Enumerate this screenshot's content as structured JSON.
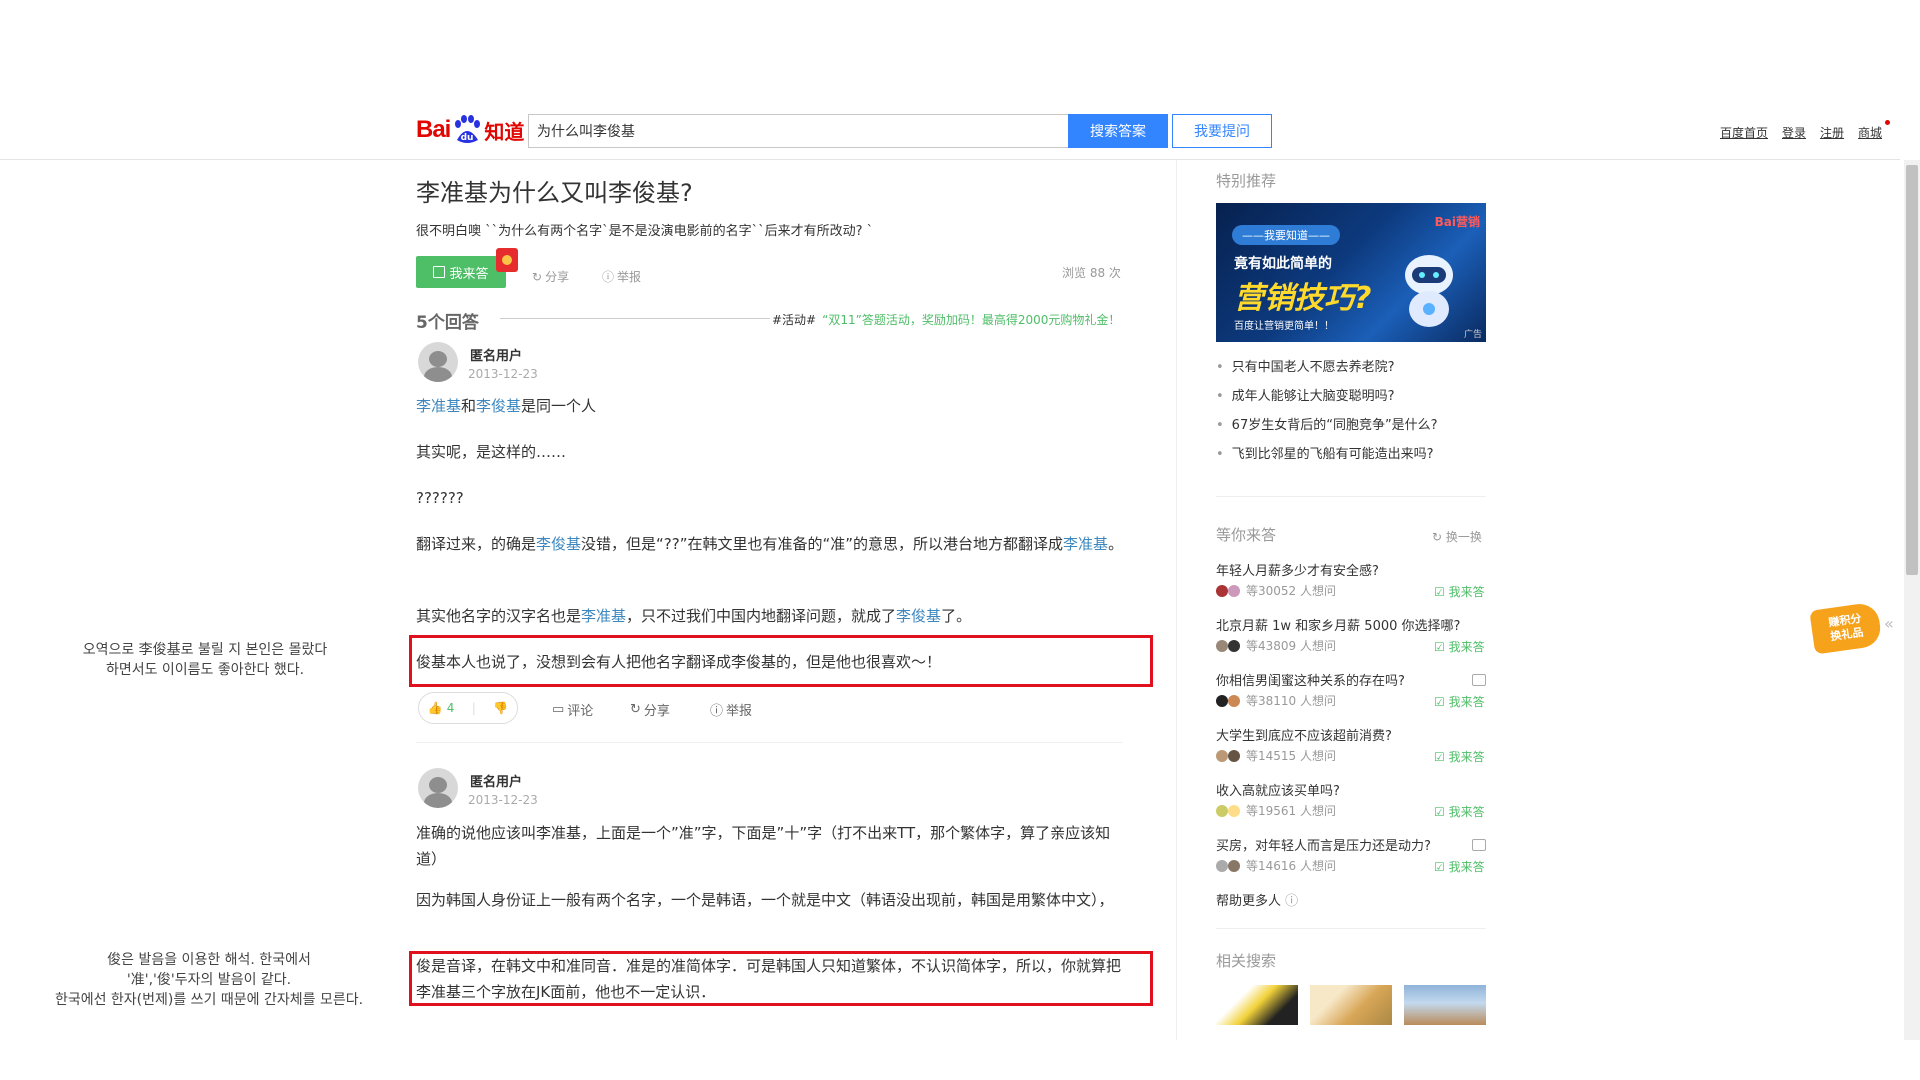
{
  "header": {
    "logo_bai": "Bai",
    "logo_du": "du",
    "logo_zhidao": "知道",
    "search_value": "为什么叫李俊基",
    "search_button": "搜索答案",
    "ask_button": "我要提问",
    "links": [
      "百度首页",
      "登录",
      "注册",
      "商城"
    ]
  },
  "question": {
    "title": "李准基为什么又叫李俊基?",
    "description": "很不明白噢 ``为什么有两个名字`是不是没演电影前的名字``后来才有所改动? `",
    "answer_button": "我来答",
    "share": "分享",
    "report": "举报",
    "views": "浏览 88 次"
  },
  "answers_header": {
    "count": "5个回答",
    "activity_tag": "#活动#",
    "activity_text": "“双11”答题活动，奖励加码！最高得2000元购物礼金！"
  },
  "answer1": {
    "user": "匿名用户",
    "date": "2013-12-23",
    "p1_link1": "李准基",
    "p1_mid": "和",
    "p1_link2": "李俊基",
    "p1_end": "是同一个人",
    "p2": "其实呢，是这样的……",
    "p3": "??????",
    "p4_a": "翻译过来，的确是",
    "p4_link": "李俊基",
    "p4_b": "没错，但是“??”在韩文里也有准备的“准”的意思，所以港台地方都翻译成",
    "p4_link2": "李准基",
    "p4_c": "。",
    "p5_a": "其实他名字的汉字名也是",
    "p5_link": "李准基",
    "p5_b": "，只不过我们中国内地翻译问题，就成了",
    "p5_link2": "李俊基",
    "p5_c": "了。",
    "p6": "俊基本人也说了，没想到会有人把他名字翻译成李俊基的，但是他也很喜欢～！",
    "likes": "4",
    "comment": "评论",
    "share": "分享",
    "report": "举报"
  },
  "answer2": {
    "user": "匿名用户",
    "date": "2013-12-23",
    "p1": "准确的说他应该叫李准基，上面是一个”准”字，下面是”十”字（打不出来TT，那个繁体字，算了亲应该知道）",
    "p2": "因为韩国人身份证上一般有两个名字，一个是韩语，一个就是中文（韩语没出现前，韩国是用繁体中文），",
    "p3": "俊是音译，在韩文中和准同音．准是的准简体字．可是韩国人只知道繁体，不认识简体字，所以，你就算把李准基三个字放在JK面前，他也不一定认识．"
  },
  "notes": {
    "note1_line1": "오역으로 李俊基로 불릴 지 본인은 몰랐다",
    "note1_line2": "하면서도 이이름도 좋아한다 했다.",
    "note2_line1": "俊은 발음을 이용한 해석. 한국에서",
    "note2_line2": "'准','俊'두자의 발음이 같다.",
    "note2_line3": "한국에선 한자(번제)를 쓰기 때문에 간자체를 모른다."
  },
  "sidebar": {
    "special_title": "特别推荐",
    "ad": {
      "brand": "Bai营销",
      "tag": "——我要知道——",
      "line2": "竟有如此简单的",
      "line3": "营销技巧?",
      "line4": "百度让营销更简单！！",
      "mark": "广告"
    },
    "recommended": [
      "只有中国老人不愿去养老院?",
      "成年人能够让大脑变聪明吗?",
      "67岁生女背后的“同胞竞争”是什么?",
      "飞到比邻星的飞船有可能造出来吗?"
    ],
    "waiting_title": "等你来答",
    "swap": "换一换",
    "waiting": [
      {
        "q": "年轻人月薪多少才有安全感?",
        "meta": "等30052 人想问",
        "ans": "我来答"
      },
      {
        "q": "北京月薪 1w 和家乡月薪 5000 你选择哪?",
        "meta": "等43809 人想问",
        "ans": "我来答"
      },
      {
        "q": "你相信男闺蜜这种关系的存在吗?",
        "meta": "等38110 人想问",
        "ans": "我来答"
      },
      {
        "q": "大学生到底应不应该超前消费?",
        "meta": "等14515 人想问",
        "ans": "我来答"
      },
      {
        "q": "收入高就应该买单吗?",
        "meta": "等19561 人想问",
        "ans": "我来答"
      },
      {
        "q": "买房，对年轻人而言是压力还是动力?",
        "meta": "等14616 人想问",
        "ans": "我来答"
      }
    ],
    "help_more": "帮助更多人",
    "related_title": "相关搜索"
  },
  "float_widget": {
    "line1": "赚积分",
    "line2": "换礼品"
  },
  "colors": {
    "brand_red": "#e10602",
    "blue": "#3385ff",
    "green": "#4ebe67",
    "link": "#3f88bf",
    "highlight": "#e0101c"
  }
}
